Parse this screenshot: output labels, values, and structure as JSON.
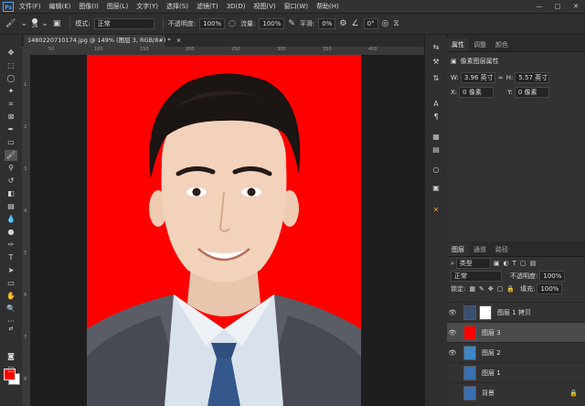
{
  "app": {
    "logo": "Ps"
  },
  "menu": [
    "文件(F)",
    "编辑(E)",
    "图像(I)",
    "图层(L)",
    "文字(Y)",
    "选择(S)",
    "滤镜(T)",
    "3D(D)",
    "视图(V)",
    "窗口(W)",
    "帮助(H)"
  ],
  "window_controls": [
    "—",
    "□",
    "✕"
  ],
  "options": {
    "brush_size": "26",
    "mode_label": "模式:",
    "mode_value": "正常",
    "opacity_label": "不透明度:",
    "opacity_value": "100%",
    "flow_label": "流量:",
    "flow_value": "100%",
    "smooth_label": "平滑:",
    "smooth_value": "0%",
    "angle_value": "0°"
  },
  "document": {
    "tab_title": "1480220710174.jpg @ 149% (图层 3, RGB/8#) *",
    "close": "×"
  },
  "ruler": {
    "h_ticks": [
      "50",
      "100",
      "150",
      "200",
      "250",
      "300",
      "350",
      "400"
    ],
    "v_ticks": [
      "1",
      "2",
      "3",
      "4",
      "5",
      "6",
      "7",
      "8"
    ]
  },
  "colors": {
    "foreground": "#ff0000",
    "background": "#ffffff",
    "canvas_bg": "#ff0000",
    "accent": "#e6a53a"
  },
  "properties": {
    "tabs": [
      "属性",
      "调整",
      "颜色"
    ],
    "section_title": "像素图层属性",
    "w_label": "W:",
    "w_value": "3.96 英寸",
    "h_label": "H:",
    "h_value": "5.57 英寸",
    "x_label": "X:",
    "x_value": "0 像素",
    "y_label": "Y:",
    "y_value": "0 像素"
  },
  "layers_panel": {
    "tabs": [
      "图层",
      "通道",
      "路径"
    ],
    "filter_label": "类型",
    "blend_mode": "正常",
    "opacity_label": "不透明度:",
    "opacity_value": "100%",
    "lock_label": "锁定:",
    "fill_label": "填充:",
    "fill_value": "100%",
    "layers": [
      {
        "name": "图层 1 拷贝",
        "visible": true,
        "active": false,
        "thumb": "photo",
        "mask": true
      },
      {
        "name": "图层 3",
        "visible": true,
        "active": true,
        "thumb": "#ff0000",
        "mask": false
      },
      {
        "name": "图层 2",
        "visible": true,
        "active": false,
        "thumb": "#3f86c8",
        "mask": false
      },
      {
        "name": "图层 1",
        "visible": false,
        "active": false,
        "thumb": "photo",
        "mask": false
      },
      {
        "name": "背景",
        "visible": false,
        "active": false,
        "thumb": "photo",
        "mask": false,
        "locked": true
      }
    ]
  }
}
